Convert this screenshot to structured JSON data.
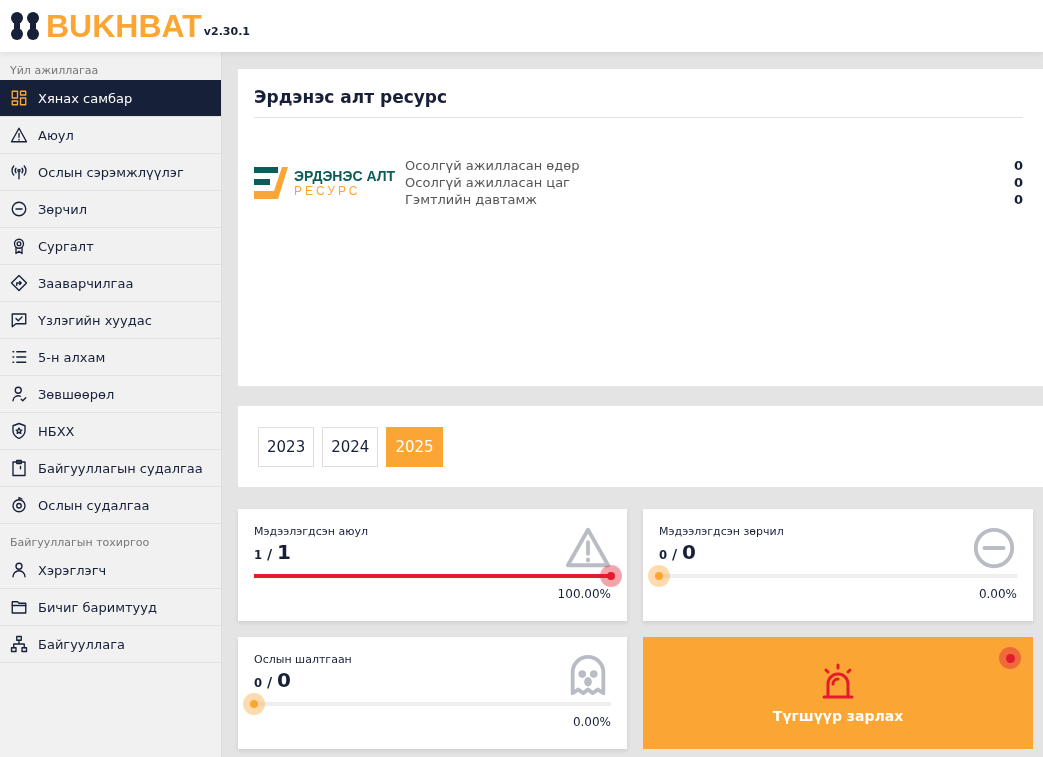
{
  "brand": {
    "name": "BUKHBAT",
    "version": "v2.30.1"
  },
  "sidebar": {
    "sections": [
      {
        "title": "Үйл ажиллагаа",
        "items": [
          {
            "label": "Хянах самбар",
            "kind": "dashboard",
            "selected": true
          },
          {
            "label": "Аюул",
            "kind": "warning",
            "selected": false
          },
          {
            "label": "Ослын сэрэмжлүүлэг",
            "kind": "signal",
            "selected": false
          },
          {
            "label": "Зөрчил",
            "kind": "minus",
            "selected": false
          },
          {
            "label": "Сургалт",
            "kind": "award",
            "selected": false
          },
          {
            "label": "Зааварчилгаа",
            "kind": "direction",
            "selected": false
          },
          {
            "label": "Үзлэгийн хуудас",
            "kind": "check",
            "selected": false
          },
          {
            "label": "5-н алхам",
            "kind": "list",
            "selected": false
          },
          {
            "label": "Зөвшөөрөл",
            "kind": "usercheck",
            "selected": false
          },
          {
            "label": "НБХХ",
            "kind": "shield",
            "selected": false
          },
          {
            "label": "Байгууллагын судалгаа",
            "kind": "clipboard",
            "selected": false
          },
          {
            "label": "Ослын судалгаа",
            "kind": "target",
            "selected": false
          }
        ]
      },
      {
        "title": "Байгууллагын тохиргоо",
        "items": [
          {
            "label": "Хэрэглэгч",
            "kind": "user",
            "selected": false
          },
          {
            "label": "Бичиг баримтууд",
            "kind": "folder",
            "selected": false
          },
          {
            "label": "Байгууллага",
            "kind": "org",
            "selected": false
          }
        ]
      }
    ]
  },
  "company": {
    "title": "Эрдэнэс алт ресурс",
    "logo": {
      "line1": "ЭРДЭНЭС АЛТ",
      "line2": "РЕСУРС"
    },
    "stats": [
      {
        "label": "Осолгүй ажилласан өдөр",
        "value": "0"
      },
      {
        "label": "Осолгүй ажилласан цаг",
        "value": "0"
      },
      {
        "label": "Гэмтлийн давтамж",
        "value": "0"
      }
    ]
  },
  "years": [
    {
      "label": "2023",
      "selected": false
    },
    {
      "label": "2024",
      "selected": false
    },
    {
      "label": "2025",
      "selected": true
    }
  ],
  "cards": [
    {
      "kind": "meter",
      "title": "Мэдээлэгдсэн аюул",
      "count": "1",
      "separator": "/",
      "total": "1",
      "level": 1,
      "percent": "100.00%",
      "color": "#e31b2c"
    },
    {
      "kind": "meter",
      "title": "Мэдээлэгдсэн зөрчил",
      "count": "0",
      "separator": "/",
      "total": "0",
      "level": 0,
      "percent": "0.00%",
      "color": "#fba634"
    },
    {
      "kind": "meter",
      "title": "Ослын шалтгаан",
      "count": "0",
      "separator": "/",
      "total": "0",
      "level": 0,
      "percent": "0.00%",
      "color": "#fba634"
    },
    {
      "kind": "alarm",
      "label": "Түгшүүр зарлах"
    }
  ]
}
